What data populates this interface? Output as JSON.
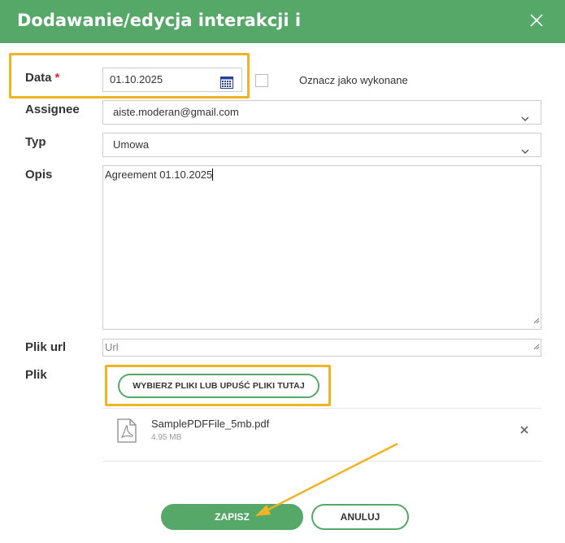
{
  "dialog": {
    "title": "Dodawanie/edycja interakcji i",
    "close_icon": "close-icon"
  },
  "form": {
    "date": {
      "label": "Data",
      "required_mark": "*",
      "value": "01.10.2025",
      "icon": "calendar-icon"
    },
    "done_checkbox": {
      "label": "Oznacz jako wykonane",
      "checked": false
    },
    "assignee": {
      "label": "Assignee",
      "value": "aiste.moderan@gmail.com"
    },
    "type": {
      "label": "Typ",
      "value": "Umowa"
    },
    "description": {
      "label": "Opis",
      "value": "Agreement 01.10.2025"
    },
    "file_url": {
      "label": "Plik url",
      "placeholder": "Url"
    },
    "file": {
      "label": "Plik",
      "upload_label": "WYBIERZ PLIKI LUB UPUŚĆ PLIKI TUTAJ",
      "attached": [
        {
          "name": "SamplePDFFile_5mb.pdf",
          "size": "4.95 MB",
          "icon": "pdf-file-icon"
        }
      ]
    }
  },
  "actions": {
    "save_label": "ZAPISZ",
    "cancel_label": "ANULUJ"
  },
  "colors": {
    "header": "#55a868",
    "accent": "#55a868",
    "highlight": "#f0b323",
    "required": "#d9232d"
  }
}
